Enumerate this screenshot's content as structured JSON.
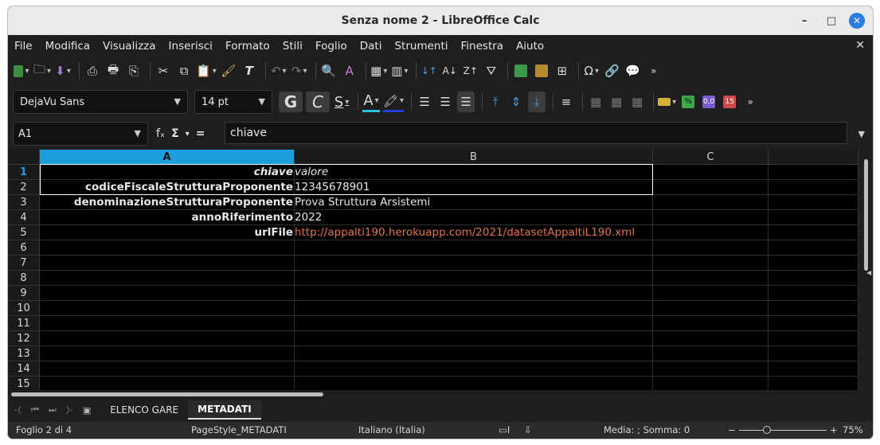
{
  "window": {
    "title": "Senza nome 2 - LibreOffice Calc"
  },
  "menu": [
    "File",
    "Modifica",
    "Visualizza",
    "Inserisci",
    "Formato",
    "Stili",
    "Foglio",
    "Dati",
    "Strumenti",
    "Finestra",
    "Aiuto"
  ],
  "format": {
    "font_name": "DejaVu Sans",
    "font_size": "14 pt"
  },
  "formula_bar": {
    "cell_ref": "A1",
    "content": "chiave",
    "fx": "fₓ",
    "sigma": "Σ",
    "equals": "="
  },
  "columns": [
    "A",
    "B",
    "C"
  ],
  "rows": [
    "1",
    "2",
    "3",
    "4",
    "5",
    "6",
    "7",
    "8",
    "9",
    "10",
    "11",
    "12",
    "13",
    "14",
    "15"
  ],
  "cells": {
    "A1": "chiave",
    "B1": "valore",
    "A2": "codiceFiscaleStrutturaProponente",
    "B2": "12345678901",
    "A3": "denominazioneStrutturaProponente",
    "B3": "Prova Struttura Arsistemi",
    "A4": "annoRiferimento",
    "B4": "2022",
    "A5": "urlFile",
    "B5": "http://appalti190.herokuapp.com/2021/datasetAppaltiL190.xml"
  },
  "sheets": [
    "ELENCO GARE",
    "METADATI"
  ],
  "active_sheet": "METADATI",
  "status": {
    "sheet_info": "Foglio 2 di 4",
    "page_style": "PageStyle_METADATI",
    "language": "Italiano (Italia)",
    "summary": "Media: ; Somma: 0",
    "zoom": "75%",
    "zoom_minus": "−",
    "zoom_plus": "+"
  },
  "colors": {
    "selection": "#1a9fdc",
    "link": "#e0744f",
    "background": "#000000"
  }
}
